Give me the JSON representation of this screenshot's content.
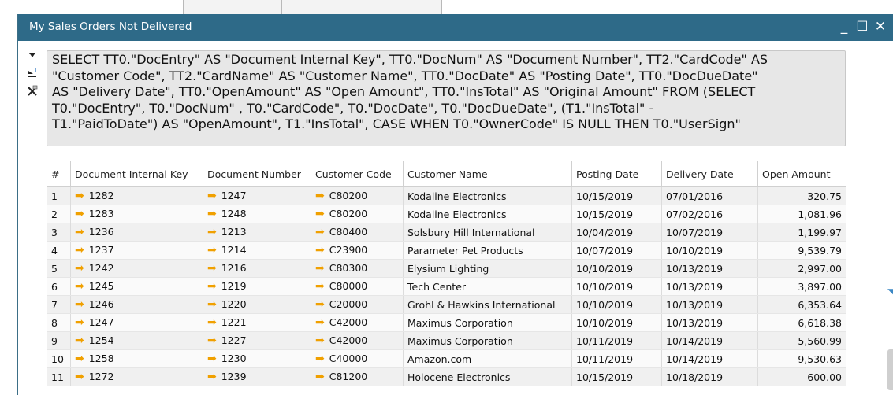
{
  "window": {
    "title": "My Sales Orders Not Delivered",
    "minimize": "_",
    "maximize": "☐",
    "close": "✕"
  },
  "query": {
    "lines": [
      "SELECT TT0.\"DocEntry\" AS \"Document Internal Key\", TT0.\"DocNum\" AS \"Document Number\", TT2.\"CardCode\" AS",
      "\"Customer Code\", TT2.\"CardName\" AS \"Customer Name\", TT0.\"DocDate\" AS \"Posting Date\", TT0.\"DocDueDate\"",
      "AS \"Delivery Date\", TT0.\"OpenAmount\" AS \"Open Amount\", TT0.\"InsTotal\" AS \"Original Amount\" FROM (SELECT",
      "T0.\"DocEntry\", T0.\"DocNum\" , T0.\"CardCode\", T0.\"DocDate\", T0.\"DocDueDate\", (T1.\"InsTotal\" -",
      "T1.\"PaidToDate\") AS \"OpenAmount\", T1.\"InsTotal\", CASE WHEN T0.\"OwnerCode\" IS NULL THEN T0.\"UserSign\""
    ]
  },
  "table": {
    "columns": [
      "#",
      "Document Internal Key",
      "Document Number",
      "Customer Code",
      "Customer Name",
      "Posting Date",
      "Delivery Date",
      "Open Amount"
    ],
    "rows": [
      [
        "1",
        "1282",
        "1247",
        "C80200",
        "Kodaline Electronics",
        "10/15/2019",
        "07/01/2016",
        "320.75"
      ],
      [
        "2",
        "1283",
        "1248",
        "C80200",
        "Kodaline Electronics",
        "10/15/2019",
        "07/02/2016",
        "1,081.96"
      ],
      [
        "3",
        "1236",
        "1213",
        "C80400",
        "Solsbury Hill International",
        "10/04/2019",
        "10/07/2019",
        "1,199.97"
      ],
      [
        "4",
        "1237",
        "1214",
        "C23900",
        "Parameter Pet Products",
        "10/07/2019",
        "10/10/2019",
        "9,539.79"
      ],
      [
        "5",
        "1242",
        "1216",
        "C80300",
        "Elysium Lighting",
        "10/10/2019",
        "10/13/2019",
        "2,997.00"
      ],
      [
        "6",
        "1245",
        "1219",
        "C80000",
        "Tech Center",
        "10/10/2019",
        "10/13/2019",
        "3,897.00"
      ],
      [
        "7",
        "1246",
        "1220",
        "C20000",
        "Grohl & Hawkins International",
        "10/10/2019",
        "10/13/2019",
        "6,353.64"
      ],
      [
        "8",
        "1247",
        "1221",
        "C42000",
        "Maximus Corporation",
        "10/10/2019",
        "10/13/2019",
        "6,618.38"
      ],
      [
        "9",
        "1254",
        "1227",
        "C42000",
        "Maximus Corporation",
        "10/11/2019",
        "10/14/2019",
        "5,560.99"
      ],
      [
        "10",
        "1258",
        "1230",
        "C40000",
        "Amazon.com",
        "10/11/2019",
        "10/14/2019",
        "9,530.63"
      ],
      [
        "11",
        "1272",
        "1239",
        "C81200",
        "Holocene Electronics",
        "10/15/2019",
        "10/18/2019",
        "600.00"
      ]
    ]
  },
  "icons": {
    "link_arrow": "➡",
    "expand": "◥"
  }
}
